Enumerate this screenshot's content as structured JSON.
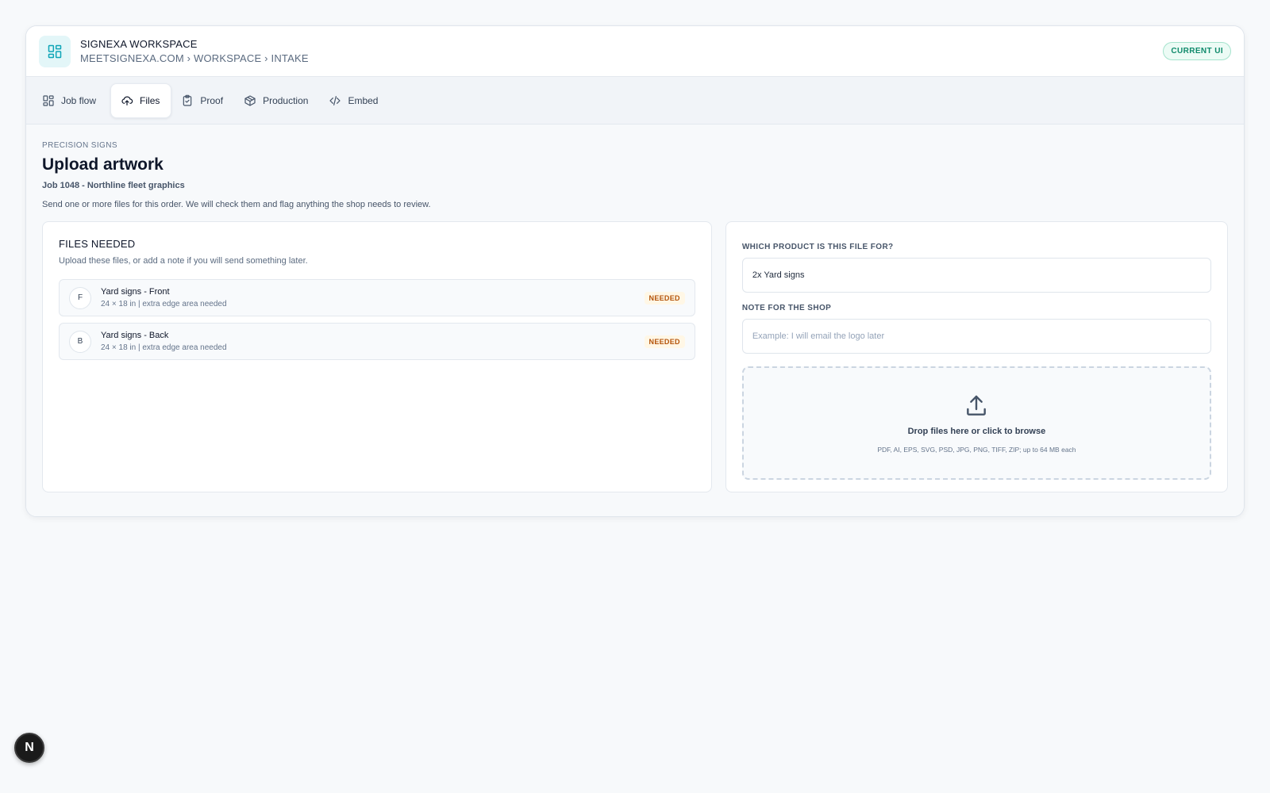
{
  "header": {
    "title": "SIGNEXA WORKSPACE",
    "breadcrumb": "MEETSIGNEXA.COM › WORKSPACE › INTAKE",
    "badge": "CURRENT UI",
    "accent": "#0ea5b7"
  },
  "tabs": [
    {
      "label": "Job flow",
      "icon": "grid-icon",
      "active": false
    },
    {
      "label": "Files",
      "icon": "cloud-upload-icon",
      "active": true
    },
    {
      "label": "Proof",
      "icon": "clipboard-check-icon",
      "active": false
    },
    {
      "label": "Production",
      "icon": "box-icon",
      "active": false
    },
    {
      "label": "Embed",
      "icon": "code-icon",
      "active": false
    }
  ],
  "page": {
    "eyebrow": "PRECISION SIGNS",
    "title": "Upload artwork",
    "job": "Job 1048 - Northline fleet graphics",
    "description": "Send one or more files for this order. We will check them and flag anything the shop needs to review."
  },
  "files_needed": {
    "title": "FILES NEEDED",
    "subtitle": "Upload these files, or add a note if you will send something later.",
    "items": [
      {
        "letter": "F",
        "name": "Yard signs - Front",
        "meta": "24 × 18 in | extra edge area needed",
        "status": "NEEDED"
      },
      {
        "letter": "B",
        "name": "Yard signs - Back",
        "meta": "24 × 18 in | extra edge area needed",
        "status": "NEEDED"
      }
    ]
  },
  "upload_form": {
    "product_label": "WHICH PRODUCT IS THIS FILE FOR?",
    "product_value": "2x Yard signs",
    "note_label": "NOTE FOR THE SHOP",
    "note_placeholder": "Example: I will email the logo later",
    "drop_title": "Drop files here or click to browse",
    "drop_sub": "PDF, AI, EPS, SVG, PSD, JPG, PNG, TIFF, ZIP; up to 64 MB each"
  },
  "fab": {
    "label": "N"
  }
}
